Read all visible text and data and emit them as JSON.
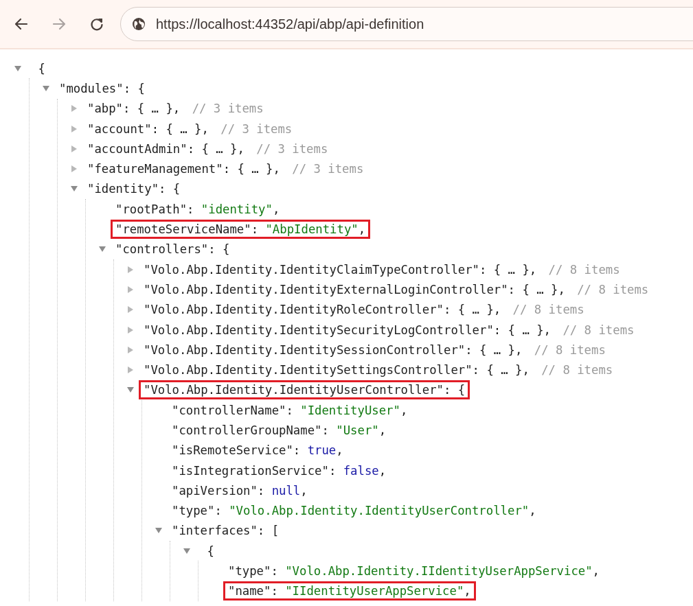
{
  "toolbar": {
    "back": {
      "disabled": false
    },
    "forward": {
      "disabled": true
    },
    "url": "https://localhost:44352/api/abp/api-definition"
  },
  "tree": {
    "kind": "object",
    "value": "{",
    "expanded": true,
    "highlighted": false,
    "children": [
      {
        "kind": "object",
        "key": "\"modules\":",
        "value": "{",
        "expanded": true,
        "highlighted": false,
        "children": [
          {
            "kind": "collapsed",
            "key": "\"abp\":",
            "value": "{ … },",
            "comment": "// 3 items",
            "expanded": false,
            "highlighted": false
          },
          {
            "kind": "collapsed",
            "key": "\"account\":",
            "value": "{ … },",
            "comment": "// 3 items",
            "expanded": false,
            "highlighted": false
          },
          {
            "kind": "collapsed",
            "key": "\"accountAdmin\":",
            "value": "{ … },",
            "comment": "// 3 items",
            "expanded": false,
            "highlighted": false
          },
          {
            "kind": "collapsed",
            "key": "\"featureManagement\":",
            "value": "{ … },",
            "comment": "// 3 items",
            "expanded": false,
            "highlighted": false
          },
          {
            "kind": "object",
            "key": "\"identity\":",
            "value": "{",
            "expanded": true,
            "highlighted": false,
            "children": [
              {
                "kind": "value",
                "key": "\"rootPath\":",
                "value": "\"identity\"",
                "color": "#137a13",
                "punct": ",",
                "highlighted": false
              },
              {
                "kind": "value",
                "key": "\"remoteServiceName\":",
                "value": "\"AbpIdentity\"",
                "color": "#137a13",
                "punct": ",",
                "highlighted": true
              },
              {
                "kind": "object",
                "key": "\"controllers\":",
                "value": "{",
                "expanded": true,
                "highlighted": false,
                "children": [
                  {
                    "kind": "collapsed",
                    "key": "\"Volo.Abp.Identity.IdentityClaimTypeController\":",
                    "value": "{ … },",
                    "comment": "// 8 items",
                    "expanded": false,
                    "highlighted": false
                  },
                  {
                    "kind": "collapsed",
                    "key": "\"Volo.Abp.Identity.IdentityExternalLoginController\":",
                    "value": "{ … },",
                    "comment": "// 8 items",
                    "expanded": false,
                    "highlighted": false
                  },
                  {
                    "kind": "collapsed",
                    "key": "\"Volo.Abp.Identity.IdentityRoleController\":",
                    "value": "{ … },",
                    "comment": "// 8 items",
                    "expanded": false,
                    "highlighted": false
                  },
                  {
                    "kind": "collapsed",
                    "key": "\"Volo.Abp.Identity.IdentitySecurityLogController\":",
                    "value": "{ … },",
                    "comment": "// 8 items",
                    "expanded": false,
                    "highlighted": false
                  },
                  {
                    "kind": "collapsed",
                    "key": "\"Volo.Abp.Identity.IdentitySessionController\":",
                    "value": "{ … },",
                    "comment": "// 8 items",
                    "expanded": false,
                    "highlighted": false
                  },
                  {
                    "kind": "collapsed",
                    "key": "\"Volo.Abp.Identity.IdentitySettingsController\":",
                    "value": "{ … },",
                    "comment": "// 8 items",
                    "expanded": false,
                    "highlighted": false
                  },
                  {
                    "kind": "object",
                    "key": "\"Volo.Abp.Identity.IdentityUserController\":",
                    "value": "{",
                    "expanded": true,
                    "highlighted": true,
                    "children": [
                      {
                        "kind": "value",
                        "key": "\"controllerName\":",
                        "value": "\"IdentityUser\"",
                        "color": "#137a13",
                        "punct": ",",
                        "highlighted": false
                      },
                      {
                        "kind": "value",
                        "key": "\"controllerGroupName\":",
                        "value": "\"User\"",
                        "color": "#137a13",
                        "punct": ",",
                        "highlighted": false
                      },
                      {
                        "kind": "value",
                        "key": "\"isRemoteService\":",
                        "value": "true",
                        "color": "#1a1aa6",
                        "punct": ",",
                        "highlighted": false
                      },
                      {
                        "kind": "value",
                        "key": "\"isIntegrationService\":",
                        "value": "false",
                        "color": "#1a1aa6",
                        "punct": ",",
                        "highlighted": false
                      },
                      {
                        "kind": "value",
                        "key": "\"apiVersion\":",
                        "value": "null",
                        "color": "#1a1aa6",
                        "punct": ",",
                        "highlighted": false
                      },
                      {
                        "kind": "value",
                        "key": "\"type\":",
                        "value": "\"Volo.Abp.Identity.IdentityUserController\"",
                        "color": "#137a13",
                        "punct": ",",
                        "highlighted": false
                      },
                      {
                        "kind": "object",
                        "key": "\"interfaces\":",
                        "value": "[",
                        "expanded": true,
                        "highlighted": false,
                        "children": [
                          {
                            "kind": "object",
                            "value": "{",
                            "expanded": true,
                            "highlighted": false,
                            "children": [
                              {
                                "kind": "value",
                                "key": "\"type\":",
                                "value": "\"Volo.Abp.Identity.IIdentityUserAppService\"",
                                "color": "#137a13",
                                "punct": ",",
                                "highlighted": false
                              },
                              {
                                "kind": "value",
                                "key": "\"name\":",
                                "value": "\"IIdentityUserAppService\"",
                                "color": "#137a13",
                                "punct": ",",
                                "highlighted": true
                              }
                            ]
                          }
                        ]
                      }
                    ]
                  }
                ]
              }
            ]
          }
        ]
      }
    ]
  }
}
